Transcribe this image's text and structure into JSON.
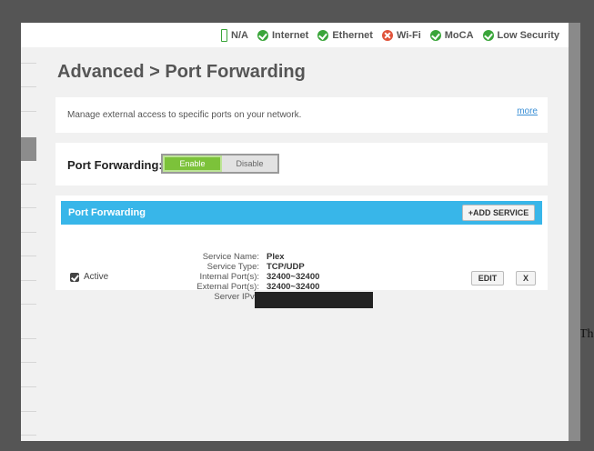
{
  "status_bar": {
    "battery": "N/A",
    "internet": "Internet",
    "ethernet": "Ethernet",
    "wifi": "Wi-Fi",
    "moca": "MoCA",
    "security": "Low Security"
  },
  "page": {
    "title": "Advanced > Port Forwarding"
  },
  "intro": {
    "text": "Manage external access to specific ports on your network.",
    "more_link": "more"
  },
  "toggle": {
    "label": "Port Forwarding:",
    "enable": "Enable",
    "disable": "Disable",
    "selected": "Enable"
  },
  "table": {
    "title": "Port Forwarding",
    "add_button": "+ADD SERVICE",
    "rows": [
      {
        "active_label": "Active",
        "service_name_label": "Service Name:",
        "service_name": "Plex",
        "service_type_label": "Service Type:",
        "service_type": "TCP/UDP",
        "internal_ports_label": "Internal Port(s):",
        "internal_ports": "32400~32400",
        "external_ports_label": "External Port(s):",
        "external_ports": "32400~32400",
        "server_ip_label": "Server IPv4",
        "edit_button": "EDIT",
        "delete_button": "X"
      }
    ]
  },
  "edge_text": "Th",
  "colors": {
    "accent": "#38b6e9",
    "enable_green": "#7cc23a",
    "status_ok": "#3aa53a",
    "status_error": "#e0533a"
  }
}
